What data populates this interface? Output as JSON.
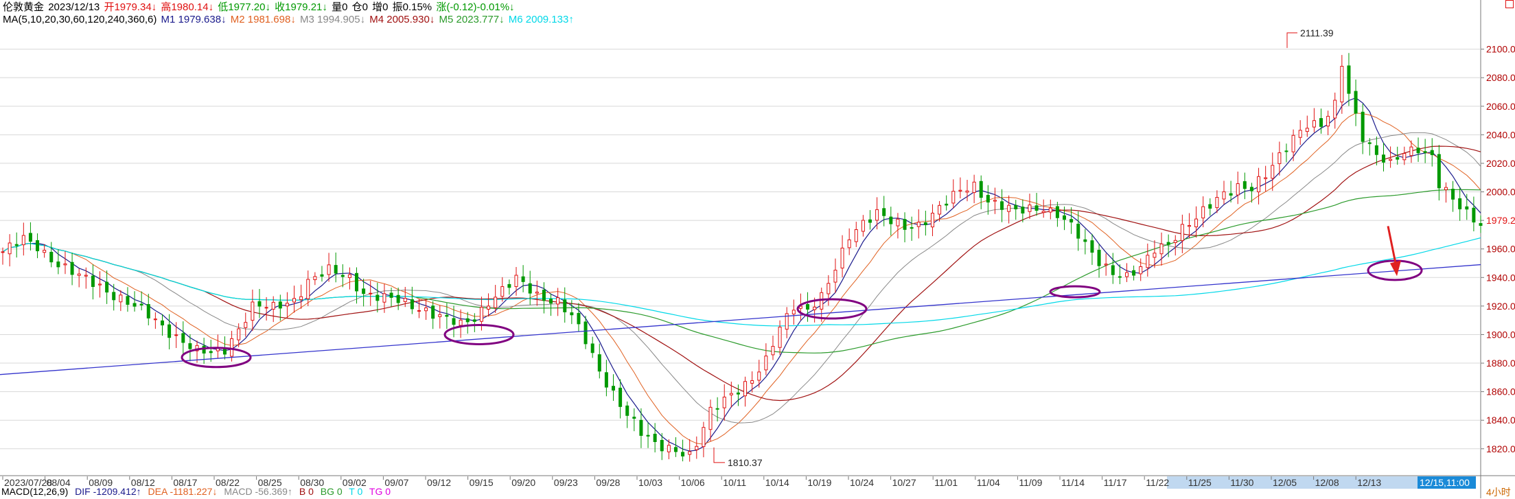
{
  "header": {
    "name": "伦敦黄金",
    "date": "2023/12/13",
    "open": "开1979.34↓",
    "high": "高1980.14↓",
    "low": "低1977.20↓",
    "close": "收1979.21↓",
    "volume": "量0",
    "position": "仓0",
    "increase": "增0",
    "amplitude": "振0.15%",
    "change": "涨(-0.12)-0.01%↓"
  },
  "ma_line": {
    "label": "MA(5,10,20,30,60,120,240,360,6)",
    "m1": "M1 1979.638↓",
    "m2": "M2 1981.698↓",
    "m3": "M3 1994.905↓",
    "m4": "M4 2005.930↓",
    "m5": "M5 2023.777↓",
    "m6": "M6 2009.133↑"
  },
  "macd_bar": {
    "label": "MACD(12,26,9)",
    "dif": "DIF -1209.412↑",
    "dea": "DEA -1181.227↓",
    "macd": "MACD -56.369↑",
    "b": "B 0",
    "bg": "BG 0",
    "t": "T 0",
    "tg": "TG 0"
  },
  "timeframe": "4小时",
  "cursor_time": "12/15,11:00",
  "colors": {
    "up": "#e01010",
    "down": "#009900",
    "m1": "#1a1a8c",
    "m2": "#e06020",
    "m3": "#888888",
    "m4": "#a01010",
    "m5": "#2a9a2a",
    "m6": "#00d8e8",
    "trendline": "#3333cc",
    "marker": "#800080",
    "arrow": "#e02020",
    "grid": "#d8d8d8",
    "axis_text": "#b00000"
  },
  "chart_data": {
    "type": "candlestick",
    "ylim": [
      1805,
      2120
    ],
    "y_ticks": [
      1820,
      1840,
      1860,
      1880,
      1900,
      1920,
      1940,
      1960,
      1980,
      2000,
      2020,
      2040,
      2060,
      2080,
      2100
    ],
    "y_tick_labels": [
      "1820.00",
      "1840.00",
      "1860.00",
      "1880.00",
      "1900.00",
      "1920.00",
      "1940.00",
      "1960.00",
      "1979.21",
      "2000.00",
      "2020.00",
      "2040.00",
      "2060.00",
      "2080.00",
      "2100.00"
    ],
    "x_labels": [
      "2023/07/28",
      "08/04",
      "08/09",
      "08/12",
      "08/17",
      "08/22",
      "08/25",
      "08/30",
      "09/02",
      "09/07",
      "09/12",
      "09/15",
      "09/20",
      "09/23",
      "09/28",
      "10/03",
      "10/06",
      "10/11",
      "10/14",
      "10/19",
      "10/24",
      "10/27",
      "11/01",
      "11/04",
      "11/09",
      "11/14",
      "11/17",
      "11/22",
      "11/25",
      "11/30",
      "12/05",
      "12/08",
      "12/13"
    ],
    "price_path": [
      [
        0,
        1958
      ],
      [
        3,
        1966
      ],
      [
        5,
        1962
      ],
      [
        8,
        1950
      ],
      [
        11,
        1940
      ],
      [
        14,
        1934
      ],
      [
        17,
        1926
      ],
      [
        20,
        1916
      ],
      [
        23,
        1906
      ],
      [
        26,
        1896
      ],
      [
        28,
        1888
      ],
      [
        30,
        1886
      ],
      [
        32,
        1890
      ],
      [
        34,
        1905
      ],
      [
        36,
        1920
      ],
      [
        39,
        1918
      ],
      [
        42,
        1925
      ],
      [
        44,
        1938
      ],
      [
        47,
        1944
      ],
      [
        50,
        1940
      ],
      [
        52,
        1930
      ],
      [
        55,
        1925
      ],
      [
        58,
        1922
      ],
      [
        61,
        1918
      ],
      [
        64,
        1910
      ],
      [
        66,
        1906
      ],
      [
        68,
        1912
      ],
      [
        70,
        1924
      ],
      [
        72,
        1931
      ],
      [
        74,
        1938
      ],
      [
        77,
        1928
      ],
      [
        80,
        1924
      ],
      [
        82,
        1912
      ],
      [
        84,
        1895
      ],
      [
        86,
        1875
      ],
      [
        88,
        1860
      ],
      [
        90,
        1844
      ],
      [
        92,
        1830
      ],
      [
        94,
        1823
      ],
      [
        96,
        1822
      ],
      [
        98,
        1818
      ],
      [
        100,
        1822
      ],
      [
        102,
        1845
      ],
      [
        104,
        1856
      ],
      [
        106,
        1863
      ],
      [
        108,
        1868
      ],
      [
        110,
        1880
      ],
      [
        112,
        1905
      ],
      [
        114,
        1922
      ],
      [
        116,
        1918
      ],
      [
        118,
        1925
      ],
      [
        120,
        1945
      ],
      [
        122,
        1970
      ],
      [
        124,
        1980
      ],
      [
        126,
        1985
      ],
      [
        128,
        1978
      ],
      [
        130,
        1975
      ],
      [
        132,
        1978
      ],
      [
        134,
        1985
      ],
      [
        136,
        1992
      ],
      [
        138,
        2000
      ],
      [
        140,
        2005
      ],
      [
        142,
        1995
      ],
      [
        144,
        1990
      ],
      [
        146,
        1985
      ],
      [
        148,
        1988
      ],
      [
        150,
        1990
      ],
      [
        152,
        1985
      ],
      [
        154,
        1975
      ],
      [
        156,
        1962
      ],
      [
        158,
        1952
      ],
      [
        160,
        1945
      ],
      [
        162,
        1940
      ],
      [
        164,
        1945
      ],
      [
        166,
        1960
      ],
      [
        168,
        1965
      ],
      [
        170,
        1975
      ],
      [
        172,
        1980
      ],
      [
        174,
        1990
      ],
      [
        176,
        2000
      ],
      [
        178,
        2005
      ],
      [
        180,
        2002
      ],
      [
        182,
        2010
      ],
      [
        184,
        2025
      ],
      [
        186,
        2040
      ],
      [
        188,
        2048
      ],
      [
        190,
        2045
      ],
      [
        192,
        2060
      ],
      [
        193,
        2090
      ],
      [
        194,
        2070
      ],
      [
        196,
        2040
      ],
      [
        198,
        2025
      ],
      [
        200,
        2018
      ],
      [
        202,
        2028
      ],
      [
        204,
        2032
      ],
      [
        206,
        2025
      ],
      [
        207,
        2005
      ],
      [
        209,
        1993
      ],
      [
        211,
        1985
      ],
      [
        213,
        1979
      ]
    ],
    "labels": [
      {
        "text": "2111.39",
        "value": 2111.39
      },
      {
        "text": "1810.37",
        "value": 1810.37
      }
    ]
  }
}
